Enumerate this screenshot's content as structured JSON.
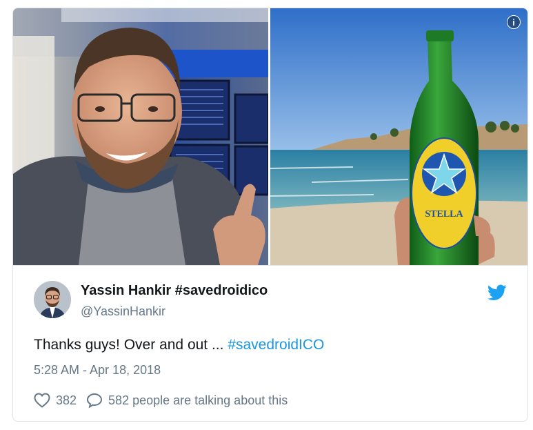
{
  "tweet": {
    "display_name": "Yassin Hankir #savedroidico",
    "handle": "@YassinHankir",
    "text_plain": "Thanks guys! Over and out ... ",
    "text_hashtag": "#savedroidICO",
    "timestamp": "5:28 AM - Apr 18, 2018",
    "like_count": "382",
    "talking_text": "582 people are talking about this"
  },
  "media": {
    "left_photo": "selfie-at-airport",
    "right_photo": "stella-beer-bottle-at-beach",
    "bottle_label": "STELLA",
    "info_icon": "i"
  },
  "icons": {
    "info": "info-icon",
    "bird": "twitter-bird-icon",
    "like": "heart-icon",
    "reply": "speech-bubble-icon"
  },
  "colors": {
    "link": "#1b95e0",
    "secondary_text": "#657786",
    "primary_text": "#14171a",
    "border": "#e1e8ed"
  }
}
